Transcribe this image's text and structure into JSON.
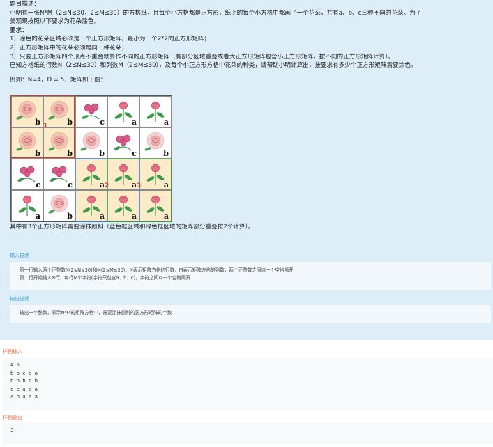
{
  "description": {
    "heading": "题目描述：",
    "line1": "小明有一张N*M（2≤N≤30，2≤M≤30）的方格纸，且每个小方格都是正方形，纸上的每个小方格中都画了一个花朵，共有a、b、c三种不同的花朵。为了",
    "line2": "美观现按照以下要求为花朵涂色。",
    "req_heading": "要求：",
    "req1": "1）涂色的花朵区域必须是一个正方形矩阵，最小为一个2*2的正方形矩阵；",
    "req2": "2）正方形矩阵中的花朵必须是同一种花朵；",
    "req3": "3）只要正方形矩阵四个顶点不重合就算作不同的正方形矩阵（有部分区域重叠或者大正方形矩阵包含小正方形矩阵，按不同的正方形矩阵计算）。",
    "task": "已知方格纸的行数N（2≤N≤30）和列数M（2≤M≤30），及每个小正方形方格中花朵的种类，请帮助小明计算出，按要求有多少个正方形矩阵需要涂色。",
    "example_intro": "例如：N=4，D = 5，矩阵如下图：",
    "caption": "其中有3个正方形矩阵需要涂抹颜料（蓝色框区域和绿色框区域的矩阵部分重叠按2个计算）。"
  },
  "grid": {
    "rows": [
      [
        "b",
        "b",
        "c",
        "a",
        "a"
      ],
      [
        "b",
        "b",
        "b",
        "c",
        "b"
      ],
      [
        "c",
        "c",
        "a",
        "a",
        "a"
      ],
      [
        "a",
        "b",
        "a",
        "a",
        "a"
      ]
    ],
    "marks": [
      "1",
      "2",
      "3"
    ]
  },
  "input_section": {
    "title": "输入描述",
    "line1": "第一行输入两个正整数N(2≤N≤30)和M(2≤M≤30)，N表示矩阵方格的行数，M表示矩阵方格的列数，两个正整数之间以一个空格隔开",
    "line2": "第二行开始输入N行，每行M个字符(字符只包含a、b、c)，字符之间以一个空格隔开"
  },
  "output_section": {
    "title": "输出描述",
    "line1": "输出一个整数，表示N*M的矩阵方格中，需要涂抹颜料的正方形矩阵的个数"
  },
  "sample_input": {
    "title": "样例输入",
    "text": "4 5\nb b c a a\nb b b c b\nc c a a a\na b a a a"
  },
  "sample_output": {
    "title": "样例输出",
    "text": "3"
  },
  "colors": {
    "panel_bg": "#deeef8",
    "section_title": "#3aa0d8",
    "sample_title": "#e2683a",
    "red_box": "#d23a2a",
    "blue_box": "#3a7fd0",
    "green_box": "#3a9a3a",
    "tint": "#fbecc7"
  }
}
